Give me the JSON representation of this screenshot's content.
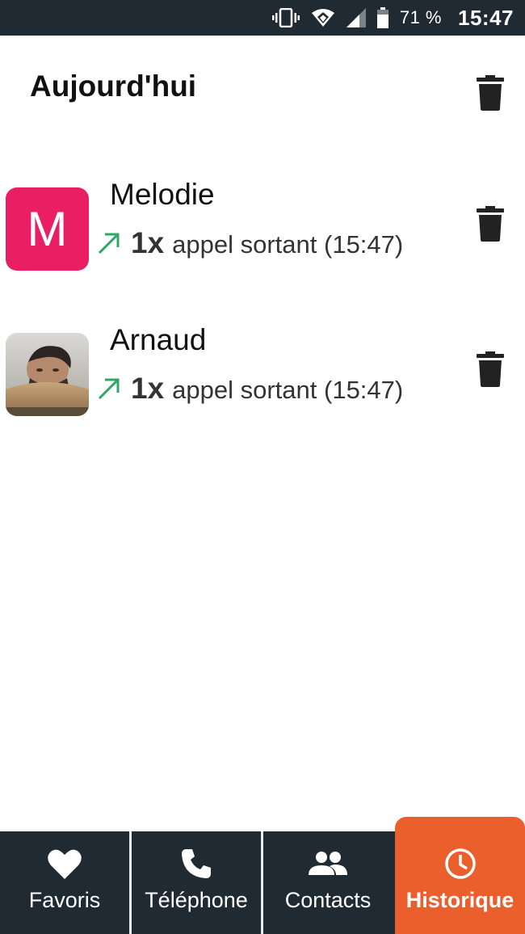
{
  "status_bar": {
    "battery_percent": "71 %",
    "time": "15:47",
    "icons": [
      "vibrate-icon",
      "wifi-icon",
      "signal-icon",
      "battery-icon"
    ]
  },
  "section": {
    "title": "Aujourd'hui",
    "delete_icon": "trash-icon"
  },
  "calls": [
    {
      "name": "Melodie",
      "avatar_letter": "M",
      "avatar_color": "#e91e63",
      "direction_icon": "outgoing-arrow-icon",
      "count": "1x",
      "description": "appel sortant (15:47)"
    },
    {
      "name": "Arnaud",
      "avatar_letter": "",
      "avatar_color": "",
      "direction_icon": "outgoing-arrow-icon",
      "count": "1x",
      "description": "appel sortant (15:47)"
    }
  ],
  "nav": {
    "items": [
      {
        "label": "Favoris",
        "icon": "heart-icon"
      },
      {
        "label": "Téléphone",
        "icon": "phone-icon"
      },
      {
        "label": "Contacts",
        "icon": "contacts-icon"
      },
      {
        "label": "Historique",
        "icon": "clock-icon"
      }
    ],
    "active_index": 3
  },
  "colors": {
    "status_bar_bg": "#1f2a33",
    "nav_bg": "#1f2a33",
    "active_tab": "#ea5f2b",
    "outgoing_arrow": "#2fa866",
    "melodie_avatar": "#e91e63"
  }
}
